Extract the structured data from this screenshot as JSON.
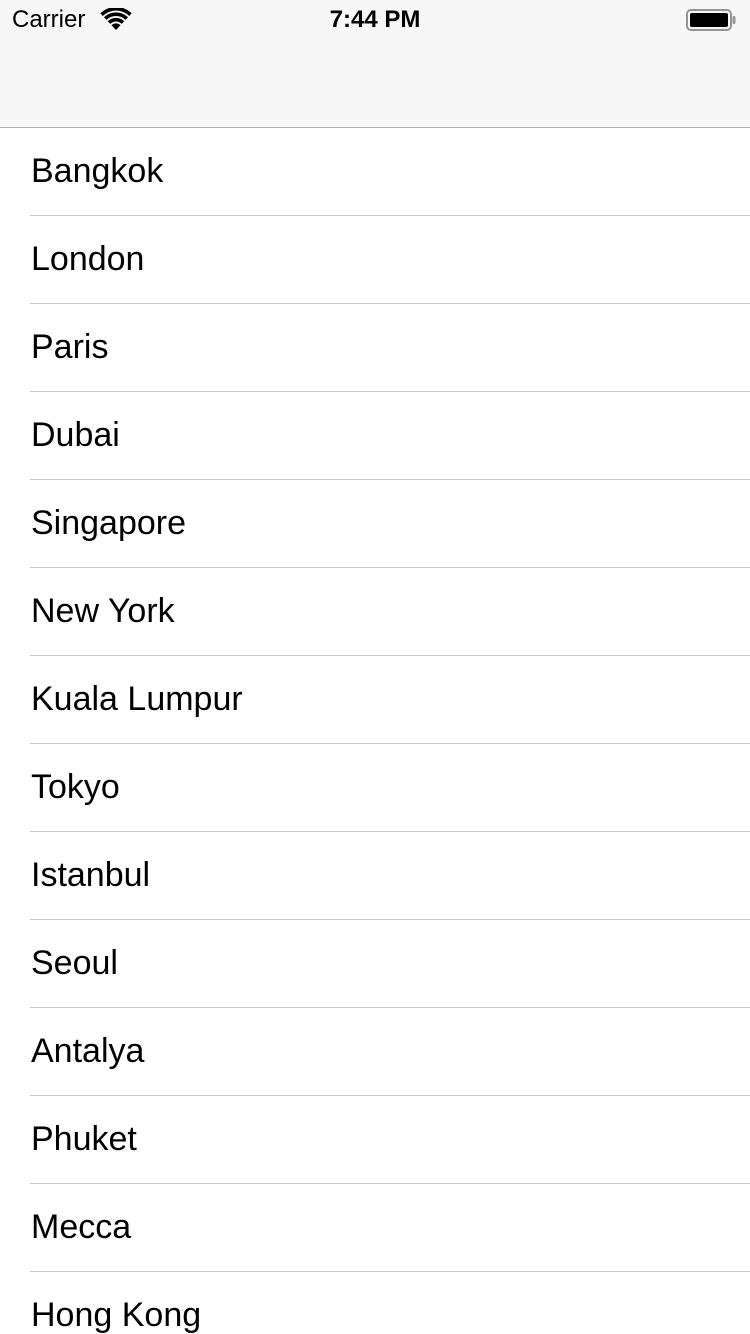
{
  "status_bar": {
    "carrier": "Carrier",
    "time": "7:44 PM",
    "wifi_icon": "wifi-icon",
    "battery_icon": "battery-full-icon"
  },
  "colors": {
    "navbar_background": "#f7f7f7",
    "separator": "#c8c7cc",
    "text": "#000000"
  },
  "cities": [
    {
      "label": "Bangkok"
    },
    {
      "label": "London"
    },
    {
      "label": "Paris"
    },
    {
      "label": "Dubai"
    },
    {
      "label": "Singapore"
    },
    {
      "label": "New York"
    },
    {
      "label": "Kuala Lumpur"
    },
    {
      "label": "Tokyo"
    },
    {
      "label": "Istanbul"
    },
    {
      "label": "Seoul"
    },
    {
      "label": "Antalya"
    },
    {
      "label": "Phuket"
    },
    {
      "label": "Mecca"
    },
    {
      "label": "Hong Kong"
    }
  ]
}
